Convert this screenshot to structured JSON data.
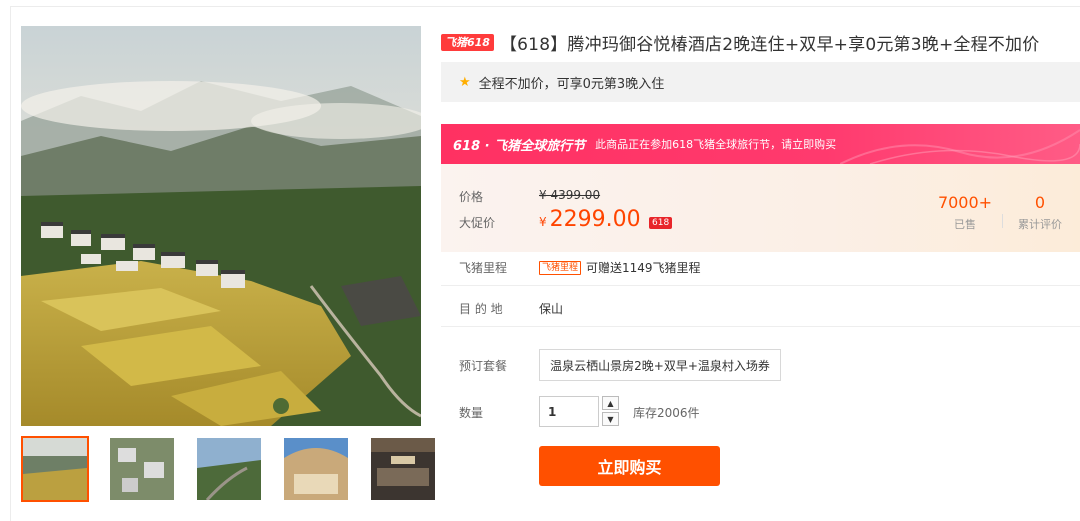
{
  "product": {
    "tag": "飞猪618",
    "title": "【618】腾冲玛御谷悦椿酒店2晚连住+双早+享0元第3晚+全程不加价",
    "subtitle": "全程不加价，可享0元第3晚入住",
    "subtitle_icon": "star-icon"
  },
  "promo": {
    "logo": "618 · 飞猪全球旅行节",
    "text": "此商品正在参加618飞猪全球旅行节，请立即购买"
  },
  "price": {
    "label_price": "价格",
    "original": "¥ 4399.00",
    "label_promo": "大促价",
    "currency": "¥",
    "promo_value": "2299.00",
    "badge": "618"
  },
  "stats": {
    "sold_value": "7000+",
    "sold_label": "已售",
    "review_value": "0",
    "review_label": "累计评价"
  },
  "mileage": {
    "label": "飞猪里程",
    "tag": "飞猪里程",
    "text": "可赠送1149飞猪里程"
  },
  "destination": {
    "label": "目 的 地",
    "value": "保山"
  },
  "package": {
    "label": "预订套餐",
    "option": "温泉云栖山景房2晚+双早+温泉村入场券"
  },
  "quantity": {
    "label": "数量",
    "value": "1",
    "stock": "库存2006件"
  },
  "buy_button": "立即购买",
  "colors": {
    "accent": "#ff5000",
    "promo_red": "#ff3162",
    "price_red": "#ff4400"
  }
}
